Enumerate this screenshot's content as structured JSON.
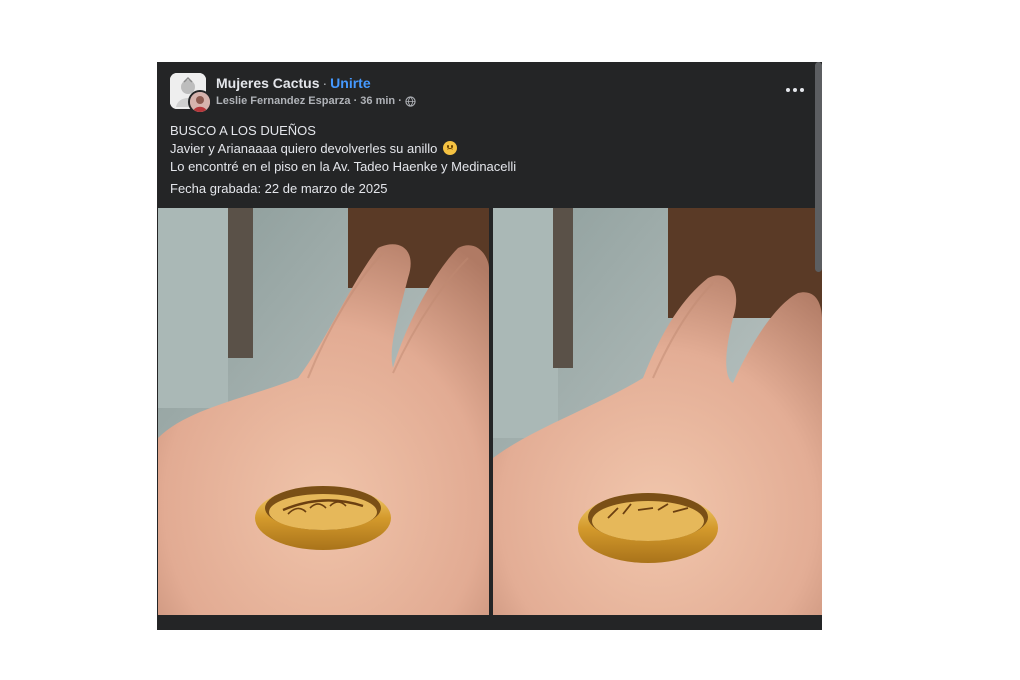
{
  "post": {
    "group_name": "Mujeres Cactus",
    "separator": "·",
    "join_label": "Unirte",
    "author": "Leslie Fernandez Esparza",
    "time": "36 min",
    "privacy_icon": "globe-icon",
    "more_icon": "more-options-icon",
    "lines": [
      "BUSCO A LOS DUEÑOS",
      "Javier y Arianaaaa quiero devolverles su anillo",
      "Lo encontré en el piso en la Av. Tadeo Haenke y Medinacelli"
    ],
    "emoji": "sad-face-emoji",
    "date_line": "Fecha grabada: 22 de marzo de 2025",
    "photos": [
      {
        "name": "ring-photo-inner-names",
        "engraving": "Javier y Arian"
      },
      {
        "name": "ring-photo-inner-date",
        "engraving": "22-03-2025"
      }
    ]
  },
  "colors": {
    "card_bg": "#242526",
    "text_primary": "#e4e6eb",
    "text_secondary": "#b0b3b8",
    "link": "#4599ff"
  }
}
